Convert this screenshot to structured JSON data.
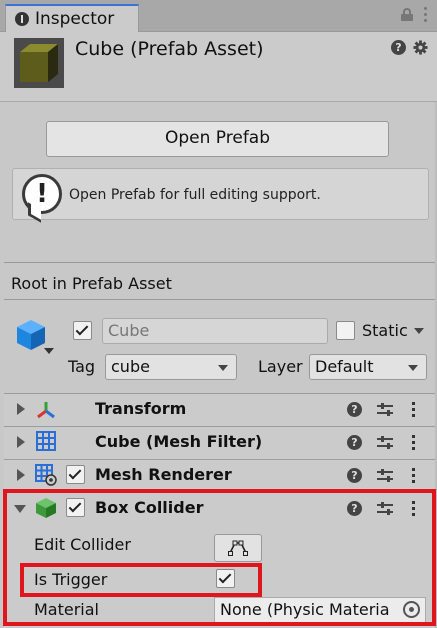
{
  "tab": {
    "label": "Inspector"
  },
  "header": {
    "title": "Cube (Prefab Asset)"
  },
  "prefab": {
    "open_button": "Open Prefab",
    "help_message": "Open Prefab for full editing support."
  },
  "root": {
    "section_label": "Root in Prefab Asset",
    "active": true,
    "name": "Cube",
    "static_label": "Static",
    "static_checked": false,
    "tag_label": "Tag",
    "tag_value": "cube",
    "layer_label": "Layer",
    "layer_value": "Default"
  },
  "components": [
    {
      "label": "Transform",
      "icon": "transform-icon",
      "expanded": false
    },
    {
      "label": "Cube (Mesh Filter)",
      "icon": "mesh-filter-icon",
      "expanded": false
    },
    {
      "label": "Mesh Renderer",
      "icon": "mesh-renderer-icon",
      "enabled": true,
      "expanded": false
    },
    {
      "label": "Box Collider",
      "icon": "box-collider-icon",
      "enabled": true,
      "expanded": true
    }
  ],
  "box_collider": {
    "edit_collider_label": "Edit Collider",
    "is_trigger_label": "Is Trigger",
    "is_trigger_checked": true,
    "material_label": "Material",
    "material_value": "None (Physic Materia"
  },
  "colors": {
    "highlight": "#e0161e",
    "cube_blue": "#1f86e0",
    "collider_green": "#3c9a3c",
    "tab_accent": "#3a72d9"
  }
}
